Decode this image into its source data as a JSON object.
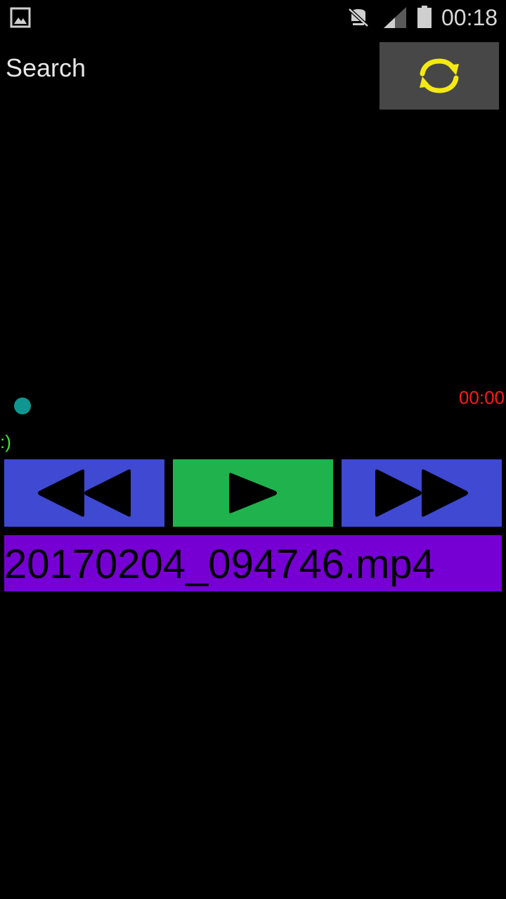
{
  "status_bar": {
    "time": "00:18",
    "icons": [
      "gallery-notification-icon",
      "mute-icon",
      "signal-icon",
      "battery-icon"
    ]
  },
  "header": {
    "search_label": "Search",
    "sync_icon": "refresh-icon",
    "sync_icon_color": "#f4ea12"
  },
  "player": {
    "time_display": "00:00",
    "status_text": ":)",
    "progress": 0,
    "controls": {
      "rewind_icon": "rewind-icon",
      "play_icon": "play-icon",
      "forward_icon": "fast-forward-icon"
    },
    "file_name": "20170204_094746.mp4"
  },
  "colors": {
    "background": "#000000",
    "seek_dot": "#0f9690",
    "time_text": "#ff1a1a",
    "status_text": "#3be63b",
    "rewind_forward_bg": "#3f49d2",
    "play_bg": "#20b24c",
    "file_bar_bg": "#7600d3",
    "sync_button_bg": "#474747"
  }
}
